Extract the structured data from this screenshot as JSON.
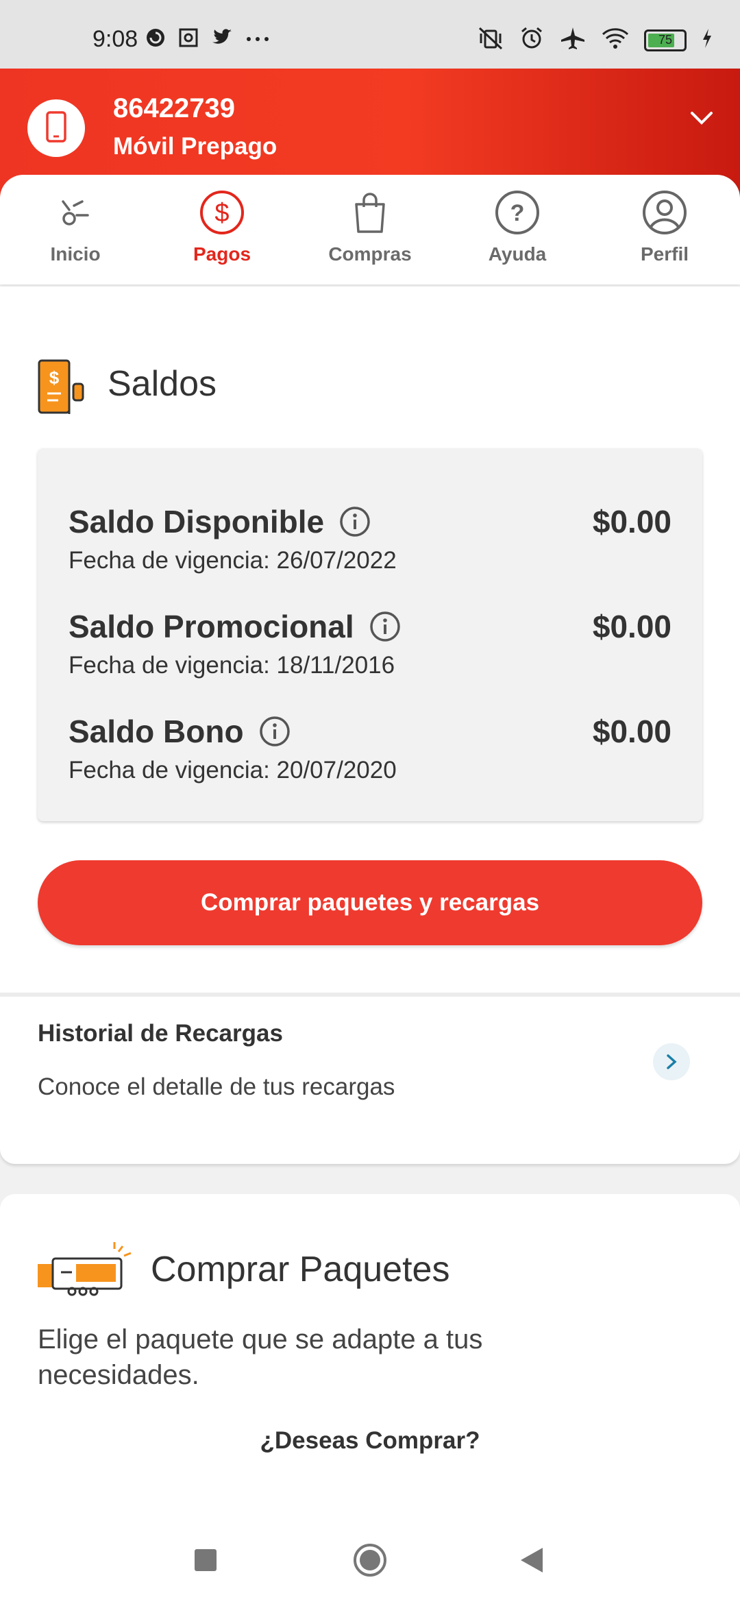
{
  "status_bar": {
    "time": "9:08",
    "left_icons": [
      "pocket-casts-icon",
      "screenshot-icon",
      "twitter-icon",
      "more-dots-icon"
    ],
    "right_icons": [
      "vibrate-off-icon",
      "alarm-icon",
      "airplane-icon",
      "wifi-icon",
      "battery-icon",
      "charging-icon"
    ],
    "battery_level": "75"
  },
  "header": {
    "number": "86422739",
    "plan": "Móvil Prepago"
  },
  "nav": {
    "items": [
      {
        "label": "Inicio",
        "icon": "home-icon"
      },
      {
        "label": "Pagos",
        "icon": "dollar-icon",
        "active": true
      },
      {
        "label": "Compras",
        "icon": "shopping-bag-icon"
      },
      {
        "label": "Ayuda",
        "icon": "help-icon"
      },
      {
        "label": "Perfil",
        "icon": "profile-icon"
      }
    ]
  },
  "saldos": {
    "title": "Saldos",
    "items": [
      {
        "name": "Saldo Disponible",
        "date": "Fecha de vigencia: 26/07/2022",
        "amount": "$0.00"
      },
      {
        "name": "Saldo Promocional",
        "date": "Fecha de vigencia: 18/11/2016",
        "amount": "$0.00"
      },
      {
        "name": "Saldo Bono",
        "date": "Fecha de vigencia: 20/07/2020",
        "amount": "$0.00"
      }
    ],
    "cta_label": "Comprar paquetes y recargas"
  },
  "historial": {
    "title": "Historial de Recargas",
    "subtitle": "Conoce el detalle de tus recargas"
  },
  "paquetes": {
    "title": "Comprar Paquetes",
    "description": "Elige el paquete que se adapte a tus necesidades.",
    "question": "¿Deseas Comprar?"
  },
  "colors": {
    "brand_red": "#ef3a2f",
    "active_red": "#e3261c",
    "accent_orange": "#f7941d"
  }
}
